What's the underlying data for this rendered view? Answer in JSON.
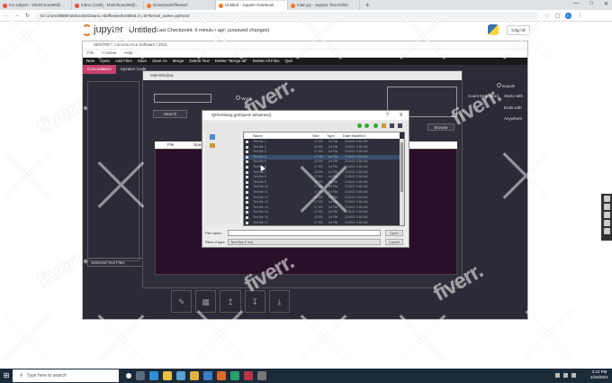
{
  "browser": {
    "tabs": [
      {
        "label": "Inv subject - khelnhman90@..."
      },
      {
        "label": "Inbox (1139) - khelnhman90@..."
      },
      {
        "label": "Downloads/flexiext/"
      },
      {
        "label": "Untitled - Jupyter Notebook"
      },
      {
        "label": "main.py - Jupyter Text Editor"
      }
    ],
    "new_tab": "+",
    "url": "localhost:8888/notebooks/Downloads/flexiext/Untitled.ipynb?kernel_name=python3",
    "profile_initial": "K"
  },
  "jupyter": {
    "brand": "jupyter",
    "notebook_title": "Untitled",
    "checkpoint": "Last Checkpoint: 6 minutes ago",
    "unsaved": "(unsaved changes)",
    "logout": "Logout"
  },
  "app": {
    "window_title": "SENTREX Concordance Software | 2021",
    "menu": [
      "File",
      "Window",
      "Help"
    ],
    "toolbar": [
      "New",
      "Open",
      "Add Files",
      "Save",
      "Save As",
      "Merge",
      "Delete Text",
      "Delete \"Merge all\"",
      "Delete All Files",
      "Quit"
    ],
    "tabs": [
      {
        "label": "Concordance",
        "active": true
      },
      {
        "label": "Speaker Code",
        "active": false
      }
    ],
    "main_window_title": "MainWindow",
    "search_button": "Search",
    "header_columns": [
      "File",
      "Speaker"
    ],
    "options": [
      "Word",
      "Equals",
      "Count Multi-word",
      "Starts with",
      "Ends with",
      "Anywhere"
    ],
    "selected_files_label": "Selected Text Files",
    "browse_button": "Browse"
  },
  "file_dialog": {
    "title": "QFileDialog.getOpenFileNames()",
    "help": "?",
    "close": "X",
    "columns": [
      "Name",
      "Size",
      "Type",
      "Date Modified"
    ],
    "rows": [
      {
        "name": "Text file 1",
        "size": "17 KB",
        "type": "txt File",
        "date": "2/18/21 9:46 AM",
        "selected": false
      },
      {
        "name": "Text file 2",
        "size": "16 KB",
        "type": "txt File",
        "date": "2/18/21 9:46 AM",
        "selected": false
      },
      {
        "name": "Text file 3",
        "size": "17 KB",
        "type": "txt File",
        "date": "2/18/21 9:46 AM",
        "selected": false
      },
      {
        "name": "Text file 4",
        "size": "17 KB",
        "type": "txt File",
        "date": "2/18/21 9:46 AM",
        "selected": true
      },
      {
        "name": "Text file 5",
        "size": "15 KB",
        "type": "txt File",
        "date": "2/18/21 9:46 AM",
        "selected": false
      },
      {
        "name": "Text file 6",
        "size": "17 KB",
        "type": "txt File",
        "date": "2/18/21 9:46 AM",
        "selected": false
      },
      {
        "name": "Text file 7",
        "size": "16 KB",
        "type": "txt File",
        "date": "2/18/21 9:46 AM",
        "selected": false
      },
      {
        "name": "Text file 8",
        "size": "17 KB",
        "type": "txt File",
        "date": "2/18/21 9:46 AM",
        "selected": false
      },
      {
        "name": "Text file 9",
        "size": "18 KB",
        "type": "txt File",
        "date": "2/18/21 9:46 AM",
        "selected": false
      },
      {
        "name": "Text file 10",
        "size": "17 KB",
        "type": "txt File",
        "date": "2/18/21 9:46 AM",
        "selected": false
      },
      {
        "name": "Text file 11",
        "size": "17 KB",
        "type": "txt File",
        "date": "2/18/21 9:46 AM",
        "selected": false
      },
      {
        "name": "Text file 12",
        "size": "16 KB",
        "type": "txt File",
        "date": "2/18/21 9:46 AM",
        "selected": false
      },
      {
        "name": "Text file 13",
        "size": "17 KB",
        "type": "txt File",
        "date": "2/18/21 9:46 AM",
        "selected": false
      },
      {
        "name": "Text file 14",
        "size": "17 KB",
        "type": "txt File",
        "date": "2/18/21 9:46 AM",
        "selected": false
      },
      {
        "name": "Text file 15",
        "size": "17 KB",
        "type": "txt File",
        "date": "2/18/21 9:46 AM",
        "selected": false
      },
      {
        "name": "Text file 16",
        "size": "16 KB",
        "type": "txt File",
        "date": "2/18/21 9:46 AM",
        "selected": false
      },
      {
        "name": "Text file 17",
        "size": "17 KB",
        "type": "txt File",
        "date": "2/18/21 9:46 AM",
        "selected": false
      }
    ],
    "file_name_label": "File name:",
    "file_type_label": "Files of type:",
    "file_type_value": "Text files (*.txt)",
    "open_button": "Open",
    "cancel_button": "Cancel"
  },
  "taskbar": {
    "search_placeholder": "Type here to search",
    "time": "3:24 PM",
    "date": "2/18/2021"
  },
  "watermark": "fiverr."
}
